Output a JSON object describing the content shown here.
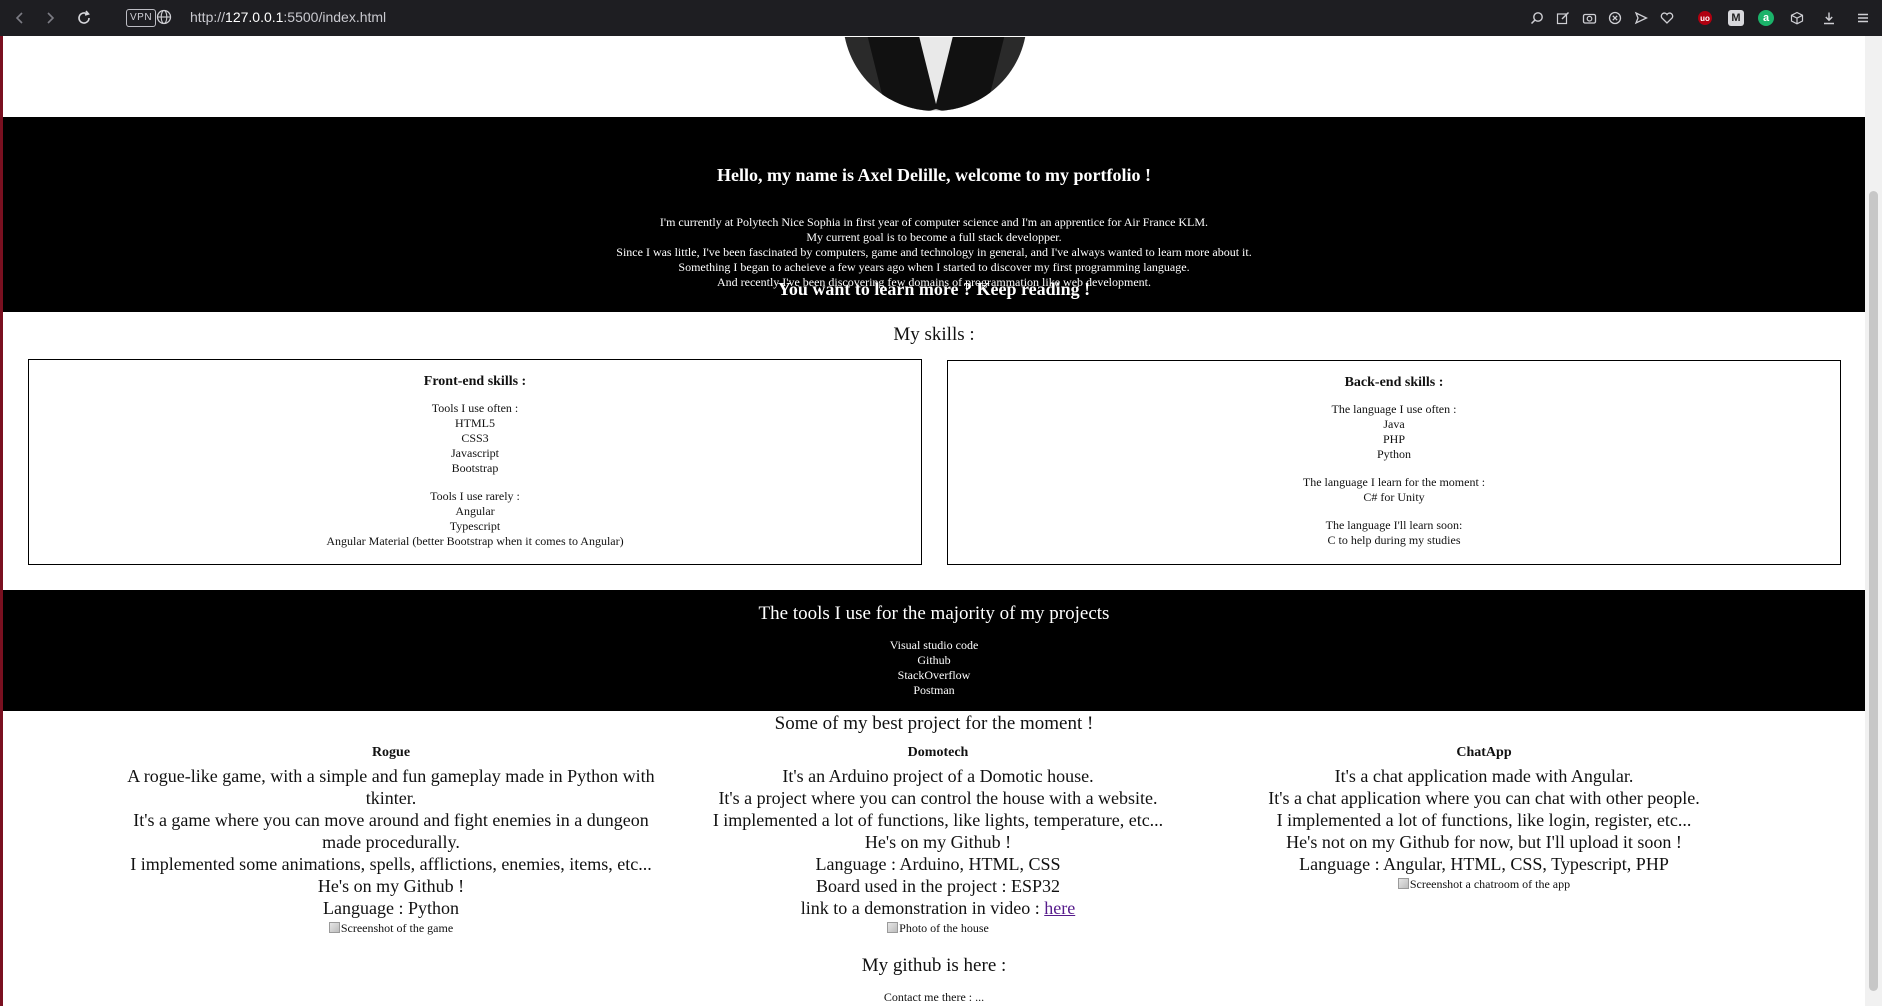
{
  "browser": {
    "url_prefix": "http://",
    "url_host": "127.0.0.1",
    "url_rest": ":5500/index.html",
    "vpn_label": "VPN",
    "icons": [
      "back-icon",
      "forward-icon",
      "reload-icon",
      "search-icon",
      "edit-icon",
      "camera-icon",
      "shield-icon",
      "send-icon",
      "heart-icon",
      "ublock-icon",
      "m-extension-icon",
      "a-extension-icon",
      "cube-icon",
      "download-icon",
      "menu-icon"
    ],
    "ext_ub": "uo",
    "ext_m": "M",
    "ext_a": "a"
  },
  "intro": {
    "title": "Hello, my name is Axel Delille, welcome to my portfolio !",
    "lines": [
      "I'm currently at Polytech Nice Sophia in first year of computer science and I'm an apprentice for Air France KLM.",
      "My current goal is to become a full stack developper.",
      "Since I was little, I've been fascinated by computers, game and technology in general, and I've always wanted to learn more about it.",
      "Something I began to acheieve a few years ago when I started to discover my first programming language.",
      "And recently I've been discovering few domains of programmation like web development."
    ],
    "cta": "You want to learn more ? Keep reading !"
  },
  "skills": {
    "title": "My skills :",
    "front": {
      "title": "Front-end skills :",
      "often_label": "Tools I use often :",
      "often": [
        "HTML5",
        "CSS3",
        "Javascript",
        "Bootstrap"
      ],
      "rarely_label": "Tools I use rarely :",
      "rarely": [
        "Angular",
        "Typescript",
        "Angular Material (better Bootstrap when it comes to Angular)"
      ]
    },
    "back": {
      "title": "Back-end skills :",
      "often_label": "The language I use often :",
      "often": [
        "Java",
        "PHP",
        "Python"
      ],
      "learning_label": "The language I learn for the moment :",
      "learning": [
        "C# for Unity"
      ],
      "soon_label": "The language I'll learn soon:",
      "soon": [
        "C to help during my studies"
      ]
    }
  },
  "tools": {
    "title": "The tools I use for the majority of my projects",
    "items": [
      "Visual studio code",
      "Github",
      "StackOverflow",
      "Postman"
    ]
  },
  "projects": {
    "title": "Some of my best project for the moment !",
    "items": [
      {
        "name": "Rogue",
        "lines": [
          "A rogue-like game, with a simple and fun gameplay made in Python with tkinter.",
          "It's a game where you can move around and fight enemies in a dungeon made procedurally.",
          "I implemented some animations, spells, afflictions, enemies, items, etc...",
          "He's on my Github !",
          "Language : Python"
        ],
        "img_alt": "Screenshot of the game"
      },
      {
        "name": "Domotech",
        "lines": [
          "It's an Arduino project of a Domotic house.",
          "It's a project where you can control the house with a website.",
          "I implemented a lot of functions, like lights, temperature, etc...",
          "He's on my Github !",
          "Language : Arduino, HTML, CSS",
          "Board used in the project : ESP32"
        ],
        "video_label": "link to a demonstration in video : ",
        "video_link": "here",
        "img_alt": "Photo of the house"
      },
      {
        "name": "ChatApp",
        "lines": [
          "It's a chat application made with Angular.",
          "It's a chat application where you can chat with other people.",
          "I implemented a lot of functions, like login, register, etc...",
          "He's not on my Github for now, but I'll upload it soon !",
          "Language : Angular, HTML, CSS, Typescript, PHP"
        ],
        "img_alt": "Screenshot a chatroom of the app"
      }
    ]
  },
  "github": {
    "title": "My github is here :",
    "contact": "Contact me there : ..."
  }
}
